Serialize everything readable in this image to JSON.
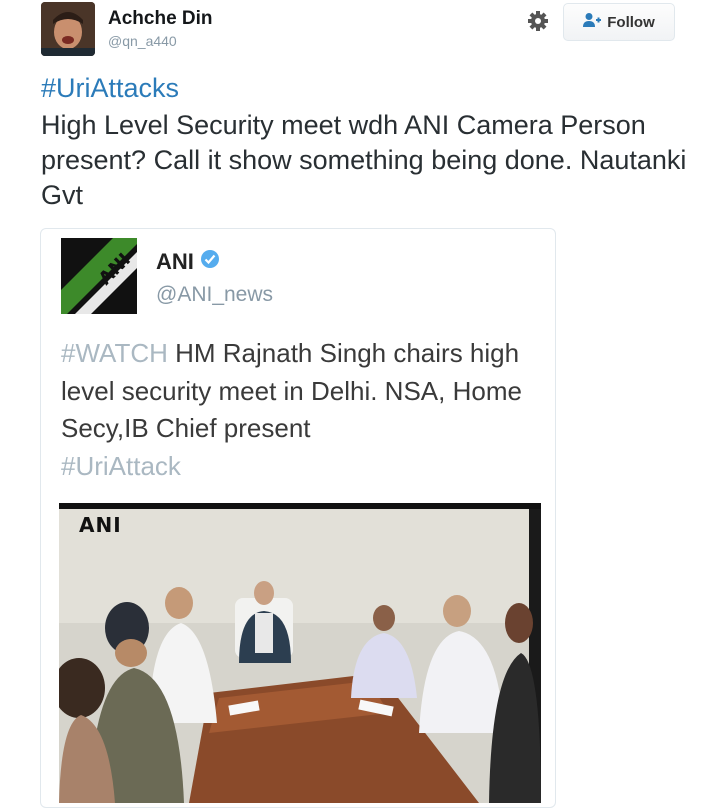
{
  "tweet": {
    "author": {
      "display_name": "Achche Din",
      "handle": "@qn_a440"
    },
    "follow_label": "Follow",
    "hashtag": "#UriAttacks",
    "text": "High Level Security meet wdh ANI Camera Person present? Call it show something being done. Nautanki Gvt"
  },
  "quoted": {
    "name": "ANI",
    "handle": "@ANI_news",
    "text_tag_start": "#WATCH",
    "text_body": " HM Rajnath Singh chairs high level security meet in Delhi. NSA, Home Secy,IB Chief present",
    "text_tag_end": "#UriAttack",
    "logo_text": "ANI",
    "media_watermark": "ANI"
  },
  "icons": [
    "gear-icon",
    "add-user-icon",
    "verified-badge-icon"
  ],
  "colors": {
    "link": "#2b7bb9",
    "muted": "#8899a6",
    "verified": "#55acee",
    "tag_muted": "#aab8c2"
  }
}
